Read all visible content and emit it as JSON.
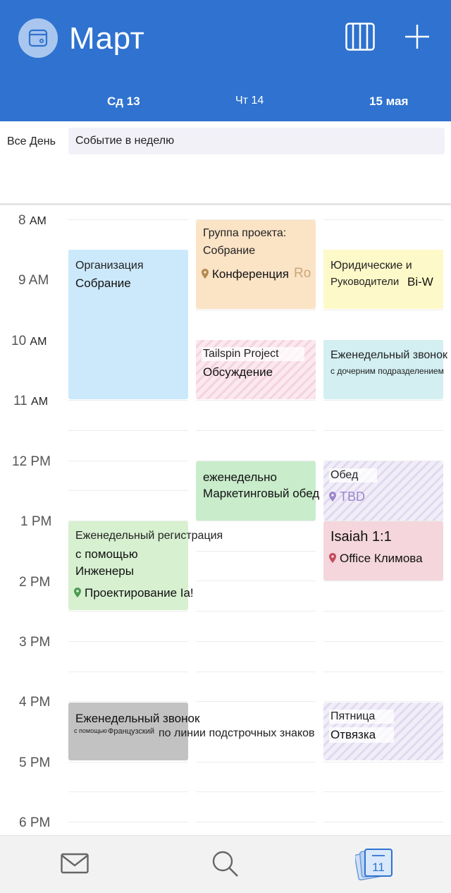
{
  "header": {
    "title": "Март",
    "days": [
      "Сд 13",
      "Чт 14",
      "15 мая"
    ],
    "bg_color": "#2f72cf"
  },
  "allday": {
    "label": "Все День",
    "event": "Событие в неделю"
  },
  "hours": [
    {
      "num": "8",
      "ampm": "AM"
    },
    {
      "num": "9 AM",
      "ampm": ""
    },
    {
      "num": "10",
      "ampm": "AM"
    },
    {
      "num": "11",
      "ampm": "AM"
    },
    {
      "num": "12 PM",
      "ampm": ""
    },
    {
      "num": "1 PM",
      "ampm": ""
    },
    {
      "num": "2 PM",
      "ampm": ""
    },
    {
      "num": "3 PM",
      "ampm": ""
    },
    {
      "num": "4 PM",
      "ampm": ""
    },
    {
      "num": "5 PM",
      "ampm": ""
    },
    {
      "num": "6 PM",
      "ampm": ""
    }
  ],
  "events": {
    "org": {
      "line1": "Организация",
      "line2": "Собрание",
      "color": "#cce9fb"
    },
    "project_group": {
      "line1": "Группа проекта:",
      "line2": "Собрание",
      "location": "Конференция",
      "location_tail": "Ro",
      "color": "#fbe3c6"
    },
    "legal": {
      "line1": "Юридические и",
      "line2": "Руководители",
      "line2_tail": "Bi-W",
      "color": "#fef9c8"
    },
    "tailspin": {
      "line1": "Tailspin Project",
      "line2": "Обсуждение"
    },
    "weekly_call": {
      "line1": "Еженедельный звонок",
      "line2": "с дочерним подразделением",
      "color": "#d3eff2"
    },
    "marketing": {
      "line1": "еженедельно",
      "line2": "Маркетинговый обед",
      "color": "#c9eccb"
    },
    "lunch": {
      "line1": "Обед",
      "location": "TBD"
    },
    "engineers": {
      "line1": "Еженедельный регистрация",
      "line2": "с помощью",
      "line3": "Инженеры",
      "location": "Проектирование Ia!",
      "color": "#d7f0d0"
    },
    "isaiah": {
      "line1": "Isaiah 1:1",
      "location": "Office Климова",
      "color": "#f4d6dc"
    },
    "french": {
      "line1": "Еженедельный звонок",
      "small_a": "с помощью",
      "small_b": "Французский",
      "tail": "по линии подстрочных знаков",
      "color": "#c2c2c2"
    },
    "friday": {
      "line1": "Пятница",
      "line2": "Отвязка"
    }
  },
  "nav": {
    "mail_icon": "mail-icon",
    "search_icon": "search-icon",
    "calendar_icon": "calendar-icon",
    "calendar_day": "11"
  }
}
